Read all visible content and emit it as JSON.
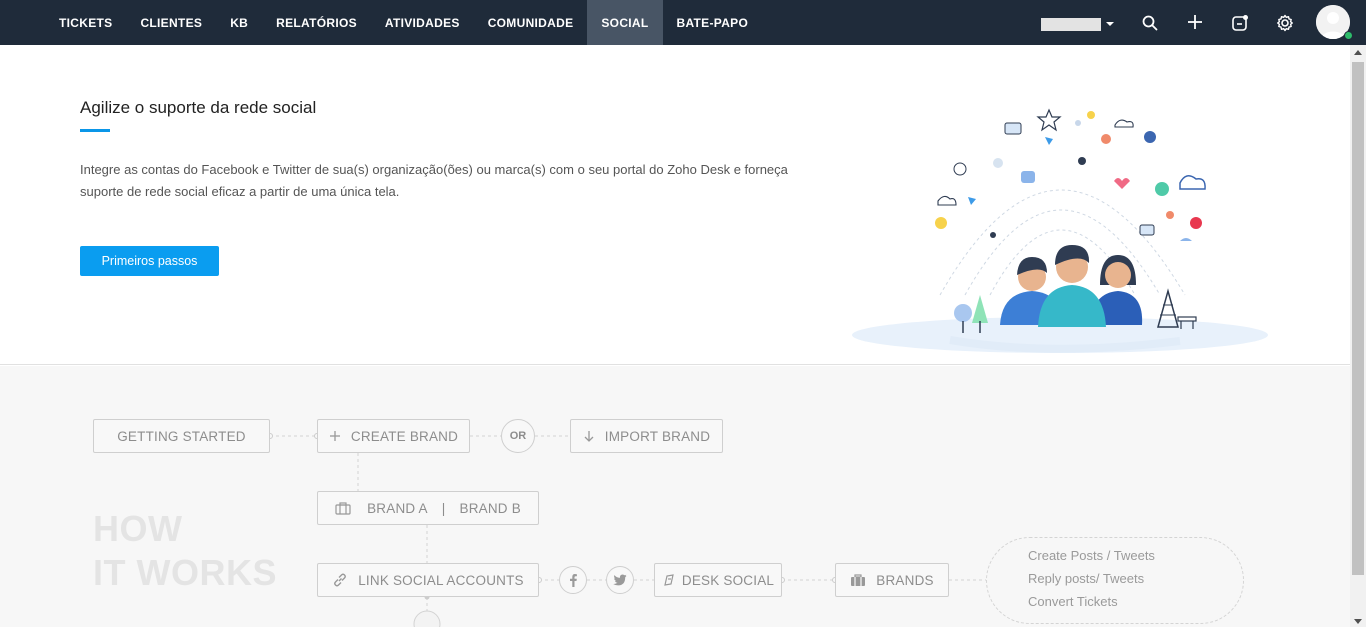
{
  "nav": {
    "tabs": [
      {
        "label": "TICKETS"
      },
      {
        "label": "CLIENTES"
      },
      {
        "label": "KB"
      },
      {
        "label": "RELATÓRIOS"
      },
      {
        "label": "ATIVIDADES"
      },
      {
        "label": "COMUNIDADE"
      },
      {
        "label": "SOCIAL",
        "active": true
      },
      {
        "label": "BATE-PAPO"
      }
    ],
    "icons": [
      "search-icon",
      "plus-icon",
      "compose-icon",
      "gear-icon"
    ],
    "colors": {
      "background": "#1f2b3a",
      "active_tab": "#485565"
    }
  },
  "hero": {
    "title": "Agilize o suporte da rede social",
    "description": "Integre as contas do Facebook e Twitter de sua(s) organização(ões) ou marca(s) com o seu portal do Zoho Desk e forneça suporte de rede social eficaz a partir de uma única tela.",
    "button_label": "Primeiros passos",
    "accent_color": "#0a9df0"
  },
  "how_it_works": {
    "heading_line1": "HOW",
    "heading_line2": "IT WORKS",
    "getting_started": "GETTING STARTED",
    "create_brand": "CREATE BRAND",
    "or_label": "OR",
    "import_brand": "IMPORT BRAND",
    "brand_a": "BRAND A",
    "brand_separator": "|",
    "brand_b": "BRAND B",
    "link_social": "LINK SOCIAL ACCOUNTS",
    "desk_social": "DESK SOCIAL",
    "brands": "BRANDS",
    "actions": [
      "Create Posts / Tweets",
      "Reply posts/ Tweets",
      "Convert Tickets"
    ]
  }
}
